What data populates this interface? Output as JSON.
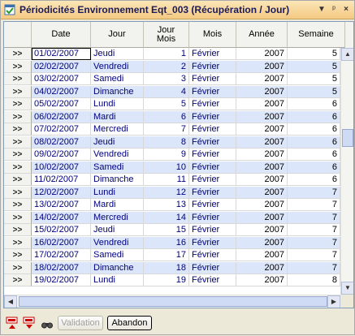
{
  "window": {
    "title": "Périodicités Environnement Eqt_003 (Récupération / Jour)",
    "controls": {
      "dropdown": "▼",
      "pin": "ᵖ",
      "close": "×"
    }
  },
  "grid": {
    "columns": [
      "Date",
      "Jour",
      "Jour\nMois",
      "Mois",
      "Année",
      "Semaine"
    ],
    "row_selector_label": ">>",
    "rows": [
      [
        "01/02/2007",
        "Jeudi",
        "1",
        "Février",
        "2007",
        "5"
      ],
      [
        "02/02/2007",
        "Vendredi",
        "2",
        "Février",
        "2007",
        "5"
      ],
      [
        "03/02/2007",
        "Samedi",
        "3",
        "Février",
        "2007",
        "5"
      ],
      [
        "04/02/2007",
        "Dimanche",
        "4",
        "Février",
        "2007",
        "5"
      ],
      [
        "05/02/2007",
        "Lundi",
        "5",
        "Février",
        "2007",
        "6"
      ],
      [
        "06/02/2007",
        "Mardi",
        "6",
        "Février",
        "2007",
        "6"
      ],
      [
        "07/02/2007",
        "Mercredi",
        "7",
        "Février",
        "2007",
        "6"
      ],
      [
        "08/02/2007",
        "Jeudi",
        "8",
        "Février",
        "2007",
        "6"
      ],
      [
        "09/02/2007",
        "Vendredi",
        "9",
        "Février",
        "2007",
        "6"
      ],
      [
        "10/02/2007",
        "Samedi",
        "10",
        "Février",
        "2007",
        "6"
      ],
      [
        "11/02/2007",
        "Dimanche",
        "11",
        "Février",
        "2007",
        "6"
      ],
      [
        "12/02/2007",
        "Lundi",
        "12",
        "Février",
        "2007",
        "7"
      ],
      [
        "13/02/2007",
        "Mardi",
        "13",
        "Février",
        "2007",
        "7"
      ],
      [
        "14/02/2007",
        "Mercredi",
        "14",
        "Février",
        "2007",
        "7"
      ],
      [
        "15/02/2007",
        "Jeudi",
        "15",
        "Février",
        "2007",
        "7"
      ],
      [
        "16/02/2007",
        "Vendredi",
        "16",
        "Février",
        "2007",
        "7"
      ],
      [
        "17/02/2007",
        "Samedi",
        "17",
        "Février",
        "2007",
        "7"
      ],
      [
        "18/02/2007",
        "Dimanche",
        "18",
        "Février",
        "2007",
        "7"
      ],
      [
        "19/02/2007",
        "Lundi",
        "19",
        "Février",
        "2007",
        "8"
      ]
    ]
  },
  "toolbar": {
    "validation_label": "Validation",
    "abandon_label": "Abandon",
    "icons": [
      "insert-row-icon",
      "delete-row-icon",
      "binoculars-icon"
    ]
  },
  "colors": {
    "row_alt": "#dbe6fb",
    "title_gradient": "#f4c982",
    "text_blue": "#000080"
  }
}
